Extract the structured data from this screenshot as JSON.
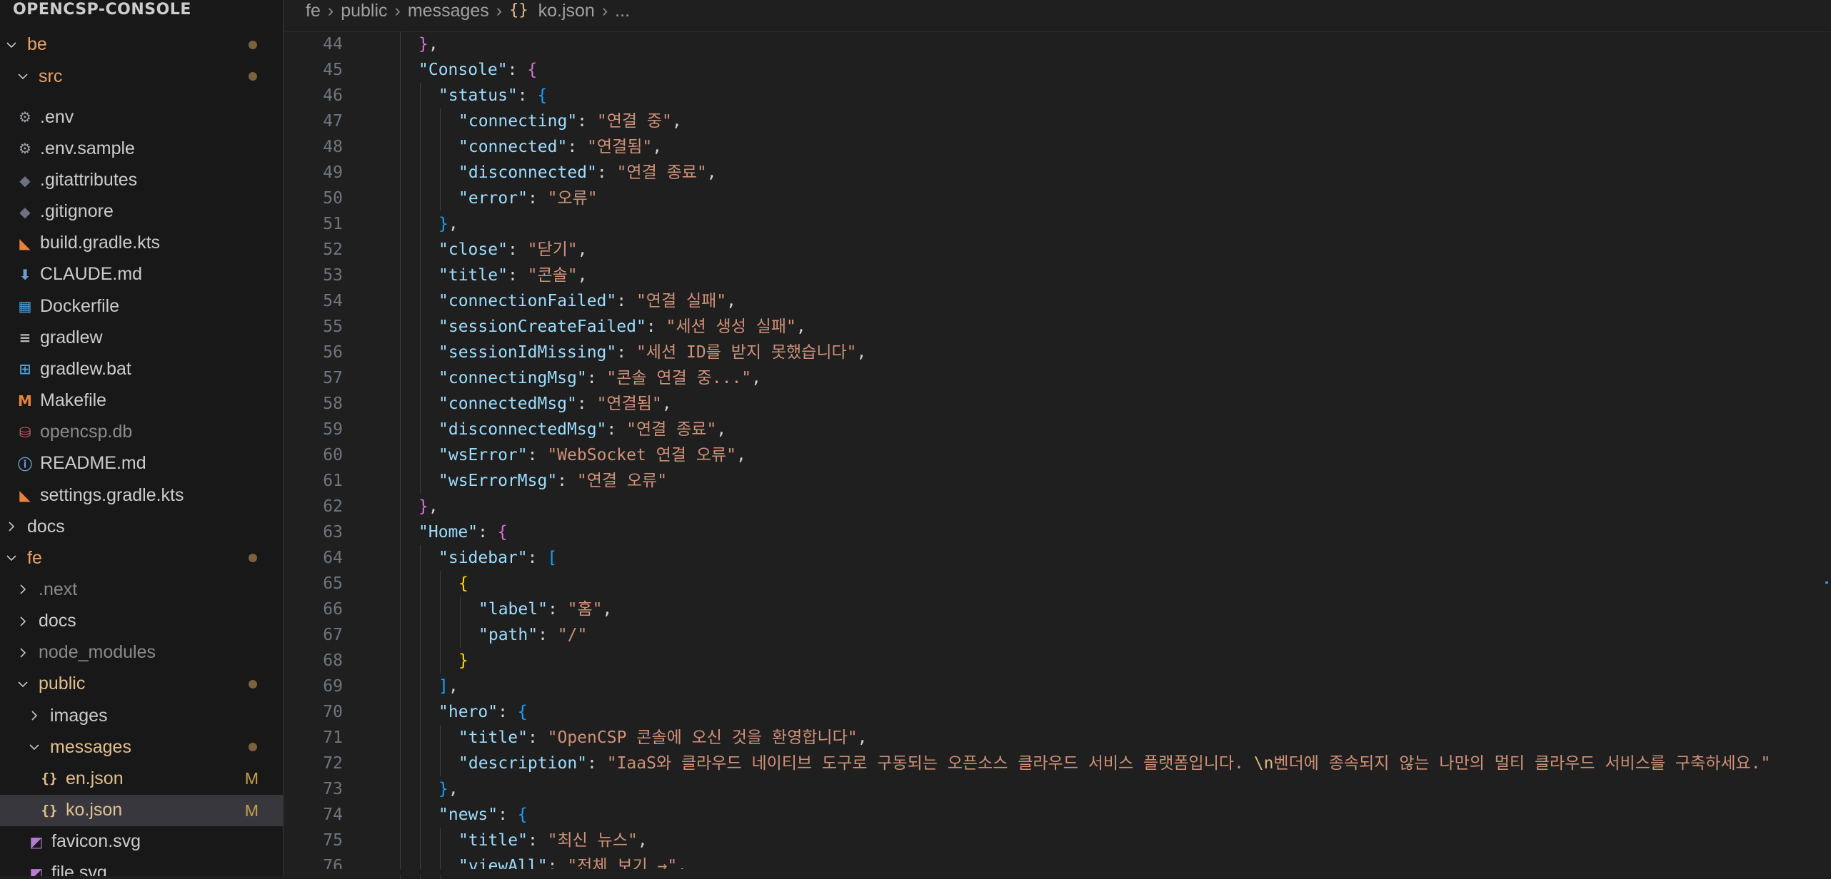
{
  "explorer": {
    "title": "OPENCSP-CONSOLE",
    "items": [
      {
        "label": "be",
        "type": "folder-open",
        "depth": 0,
        "color": "orange",
        "dot": true
      },
      {
        "label": "src",
        "type": "folder-open",
        "depth": 1,
        "color": "orange",
        "dot": true
      },
      {
        "label": ".env",
        "type": "file",
        "depth": 1,
        "icon": "gear-icon"
      },
      {
        "label": ".env.sample",
        "type": "file",
        "depth": 1,
        "icon": "gear-icon"
      },
      {
        "label": ".gitattributes",
        "type": "file",
        "depth": 1,
        "icon": "git-icon"
      },
      {
        "label": ".gitignore",
        "type": "file",
        "depth": 1,
        "icon": "git-icon"
      },
      {
        "label": "build.gradle.kts",
        "type": "file",
        "depth": 1,
        "icon": "kotlin-icon"
      },
      {
        "label": "CLAUDE.md",
        "type": "file",
        "depth": 1,
        "icon": "markdown-download-icon"
      },
      {
        "label": "Dockerfile",
        "type": "file",
        "depth": 1,
        "icon": "docker-icon"
      },
      {
        "label": "gradlew",
        "type": "file",
        "depth": 1,
        "icon": "text-lines-icon"
      },
      {
        "label": "gradlew.bat",
        "type": "file",
        "depth": 1,
        "icon": "windows-icon"
      },
      {
        "label": "Makefile",
        "type": "file",
        "depth": 1,
        "icon": "makefile-icon"
      },
      {
        "label": "opencsp.db",
        "type": "file",
        "depth": 1,
        "icon": "database-icon",
        "dim": true
      },
      {
        "label": "README.md",
        "type": "file",
        "depth": 1,
        "icon": "info-icon"
      },
      {
        "label": "settings.gradle.kts",
        "type": "file",
        "depth": 1,
        "icon": "kotlin-icon"
      },
      {
        "label": "docs",
        "type": "folder-closed",
        "depth": 0
      },
      {
        "label": "fe",
        "type": "folder-open",
        "depth": 0,
        "color": "orange",
        "dot": true
      },
      {
        "label": ".next",
        "type": "folder-closed",
        "depth": 1,
        "dim": true
      },
      {
        "label": "docs",
        "type": "folder-closed",
        "depth": 1
      },
      {
        "label": "node_modules",
        "type": "folder-closed",
        "depth": 1,
        "dim": true
      },
      {
        "label": "public",
        "type": "folder-open",
        "depth": 1,
        "color": "yellow",
        "dot": true
      },
      {
        "label": "images",
        "type": "folder-closed",
        "depth": 2
      },
      {
        "label": "messages",
        "type": "folder-open",
        "depth": 2,
        "color": "yellow",
        "dot": true
      },
      {
        "label": "en.json",
        "type": "file",
        "depth": 3,
        "icon": "json-braces-icon",
        "color": "yellow",
        "badge": "M"
      },
      {
        "label": "ko.json",
        "type": "file",
        "depth": 3,
        "icon": "json-braces-icon",
        "color": "yellow",
        "badge": "M",
        "selected": true
      },
      {
        "label": "favicon.svg",
        "type": "file",
        "depth": 2,
        "icon": "svg-icon"
      },
      {
        "label": "file.svg",
        "type": "file",
        "depth": 2,
        "icon": "svg-icon"
      }
    ]
  },
  "breadcrumb": [
    "fe",
    "public",
    "messages",
    "ko.json",
    "..."
  ],
  "editor": {
    "lines": [
      {
        "n": "44",
        "indent": 1,
        "parts": [
          [
            "b2",
            "}"
          ],
          [
            "p",
            ","
          ]
        ]
      },
      {
        "n": "45",
        "indent": 1,
        "parts": [
          [
            "k",
            "\"Console\""
          ],
          [
            "p",
            ": "
          ],
          [
            "b2",
            "{"
          ]
        ]
      },
      {
        "n": "46",
        "indent": 2,
        "parts": [
          [
            "k",
            "\"status\""
          ],
          [
            "p",
            ": "
          ],
          [
            "b3",
            "{"
          ]
        ]
      },
      {
        "n": "47",
        "indent": 3,
        "parts": [
          [
            "k",
            "\"connecting\""
          ],
          [
            "p",
            ": "
          ],
          [
            "s",
            "\"연결 중\""
          ],
          [
            "p",
            ","
          ]
        ]
      },
      {
        "n": "48",
        "indent": 3,
        "parts": [
          [
            "k",
            "\"connected\""
          ],
          [
            "p",
            ": "
          ],
          [
            "s",
            "\"연결됨\""
          ],
          [
            "p",
            ","
          ]
        ]
      },
      {
        "n": "49",
        "indent": 3,
        "parts": [
          [
            "k",
            "\"disconnected\""
          ],
          [
            "p",
            ": "
          ],
          [
            "s",
            "\"연결 종료\""
          ],
          [
            "p",
            ","
          ]
        ]
      },
      {
        "n": "50",
        "indent": 3,
        "parts": [
          [
            "k",
            "\"error\""
          ],
          [
            "p",
            ": "
          ],
          [
            "s",
            "\"오류\""
          ]
        ]
      },
      {
        "n": "51",
        "indent": 2,
        "parts": [
          [
            "b3",
            "}"
          ],
          [
            "p",
            ","
          ]
        ]
      },
      {
        "n": "52",
        "indent": 2,
        "parts": [
          [
            "k",
            "\"close\""
          ],
          [
            "p",
            ": "
          ],
          [
            "s",
            "\"닫기\""
          ],
          [
            "p",
            ","
          ]
        ]
      },
      {
        "n": "53",
        "indent": 2,
        "parts": [
          [
            "k",
            "\"title\""
          ],
          [
            "p",
            ": "
          ],
          [
            "s",
            "\"콘솔\""
          ],
          [
            "p",
            ","
          ]
        ]
      },
      {
        "n": "54",
        "indent": 2,
        "parts": [
          [
            "k",
            "\"connectionFailed\""
          ],
          [
            "p",
            ": "
          ],
          [
            "s",
            "\"연결 실패\""
          ],
          [
            "p",
            ","
          ]
        ]
      },
      {
        "n": "55",
        "indent": 2,
        "parts": [
          [
            "k",
            "\"sessionCreateFailed\""
          ],
          [
            "p",
            ": "
          ],
          [
            "s",
            "\"세션 생성 실패\""
          ],
          [
            "p",
            ","
          ]
        ]
      },
      {
        "n": "56",
        "indent": 2,
        "parts": [
          [
            "k",
            "\"sessionIdMissing\""
          ],
          [
            "p",
            ": "
          ],
          [
            "s",
            "\"세션 ID를 받지 못했습니다\""
          ],
          [
            "p",
            ","
          ]
        ]
      },
      {
        "n": "57",
        "indent": 2,
        "parts": [
          [
            "k",
            "\"connectingMsg\""
          ],
          [
            "p",
            ": "
          ],
          [
            "s",
            "\"콘솔 연결 중...\""
          ],
          [
            "p",
            ","
          ]
        ]
      },
      {
        "n": "58",
        "indent": 2,
        "parts": [
          [
            "k",
            "\"connectedMsg\""
          ],
          [
            "p",
            ": "
          ],
          [
            "s",
            "\"연결됨\""
          ],
          [
            "p",
            ","
          ]
        ]
      },
      {
        "n": "59",
        "indent": 2,
        "parts": [
          [
            "k",
            "\"disconnectedMsg\""
          ],
          [
            "p",
            ": "
          ],
          [
            "s",
            "\"연결 종료\""
          ],
          [
            "p",
            ","
          ]
        ]
      },
      {
        "n": "60",
        "indent": 2,
        "parts": [
          [
            "k",
            "\"wsError\""
          ],
          [
            "p",
            ": "
          ],
          [
            "s",
            "\"WebSocket 연결 오류\""
          ],
          [
            "p",
            ","
          ]
        ]
      },
      {
        "n": "61",
        "indent": 2,
        "parts": [
          [
            "k",
            "\"wsErrorMsg\""
          ],
          [
            "p",
            ": "
          ],
          [
            "s",
            "\"연결 오류\""
          ]
        ]
      },
      {
        "n": "62",
        "indent": 1,
        "parts": [
          [
            "b2",
            "}"
          ],
          [
            "p",
            ","
          ]
        ]
      },
      {
        "n": "63",
        "indent": 1,
        "parts": [
          [
            "k",
            "\"Home\""
          ],
          [
            "p",
            ": "
          ],
          [
            "b2",
            "{"
          ]
        ]
      },
      {
        "n": "64",
        "indent": 2,
        "parts": [
          [
            "k",
            "\"sidebar\""
          ],
          [
            "p",
            ": "
          ],
          [
            "b3",
            "["
          ]
        ]
      },
      {
        "n": "65",
        "indent": 3,
        "parts": [
          [
            "b1",
            "{"
          ]
        ]
      },
      {
        "n": "66",
        "indent": 4,
        "parts": [
          [
            "k",
            "\"label\""
          ],
          [
            "p",
            ": "
          ],
          [
            "s",
            "\"홈\""
          ],
          [
            "p",
            ","
          ]
        ]
      },
      {
        "n": "67",
        "indent": 4,
        "parts": [
          [
            "k",
            "\"path\""
          ],
          [
            "p",
            ": "
          ],
          [
            "s",
            "\"/\""
          ]
        ]
      },
      {
        "n": "68",
        "indent": 3,
        "parts": [
          [
            "b1",
            "}"
          ]
        ]
      },
      {
        "n": "69",
        "indent": 2,
        "parts": [
          [
            "b3",
            "]"
          ],
          [
            "p",
            ","
          ]
        ]
      },
      {
        "n": "70",
        "indent": 2,
        "parts": [
          [
            "k",
            "\"hero\""
          ],
          [
            "p",
            ": "
          ],
          [
            "b3",
            "{"
          ]
        ]
      },
      {
        "n": "71",
        "indent": 3,
        "parts": [
          [
            "k",
            "\"title\""
          ],
          [
            "p",
            ": "
          ],
          [
            "s",
            "\"OpenCSP 콘솔에 오신 것을 환영합니다\""
          ],
          [
            "p",
            ","
          ]
        ]
      },
      {
        "n": "72",
        "indent": 3,
        "parts": [
          [
            "k",
            "\"description\""
          ],
          [
            "p",
            ": "
          ],
          [
            "s",
            "\"IaaS와 클라우드 네이티브 도구로 구동되는 오픈소스 클라우드 서비스 플랫폼입니다. "
          ],
          [
            "esc",
            "\\n"
          ],
          [
            "s",
            "벤더에 종속되지 않는 나만의 멀티 클라우드 서비스를 구축하세요.\""
          ]
        ]
      },
      {
        "n": "73",
        "indent": 2,
        "parts": [
          [
            "b3",
            "}"
          ],
          [
            "p",
            ","
          ]
        ]
      },
      {
        "n": "74",
        "indent": 2,
        "parts": [
          [
            "k",
            "\"news\""
          ],
          [
            "p",
            ": "
          ],
          [
            "b3",
            "{"
          ]
        ]
      },
      {
        "n": "75",
        "indent": 3,
        "parts": [
          [
            "k",
            "\"title\""
          ],
          [
            "p",
            ": "
          ],
          [
            "s",
            "\"최신 뉴스\""
          ],
          [
            "p",
            ","
          ]
        ]
      },
      {
        "n": "76",
        "indent": 3,
        "parts": [
          [
            "k",
            "\"viewAll\""
          ],
          [
            "p",
            ": "
          ],
          [
            "s",
            "\"전체 보기 →\""
          ],
          [
            "p",
            ","
          ]
        ]
      }
    ]
  },
  "colors": {
    "key": "#9cdcfe",
    "string": "#ce9178",
    "bracket_gold": "#ffd700",
    "bracket_purple": "#da70d6",
    "bracket_blue": "#179fff",
    "modified": "#c8a04a",
    "folder_orange": "#e8a36b",
    "folder_yellow": "#e2c08d"
  }
}
